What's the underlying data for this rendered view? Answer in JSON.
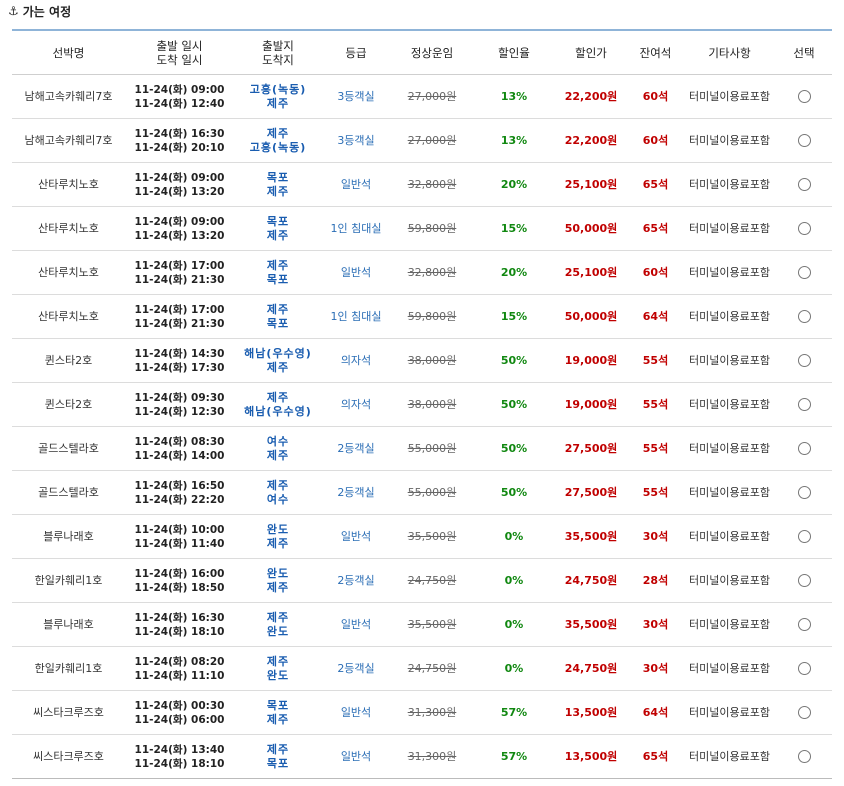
{
  "section": {
    "title": "가는 여정",
    "icon": "anchor-icon"
  },
  "headers": {
    "ship": "선박명",
    "time_top": "출발 일시",
    "time_bottom": "도착 일시",
    "port_top": "출발지",
    "port_bottom": "도착지",
    "grade": "등급",
    "normal": "정상운임",
    "rate": "할인율",
    "price": "할인가",
    "seats": "잔여석",
    "etc": "기타사항",
    "select": "선택"
  },
  "rows": [
    {
      "ship": "남해고속카훼리7호",
      "dep": "11-24(화) 09:00",
      "arr": "11-24(화) 12:40",
      "from": "고흥(녹동)",
      "to": "제주",
      "grade": "3등객실",
      "normal": "27,000원",
      "rate": "13%",
      "price": "22,200원",
      "seats": "60석",
      "etc": "터미널이용료포함"
    },
    {
      "ship": "남해고속카훼리7호",
      "dep": "11-24(화) 16:30",
      "arr": "11-24(화) 20:10",
      "from": "제주",
      "to": "고흥(녹동)",
      "grade": "3등객실",
      "normal": "27,000원",
      "rate": "13%",
      "price": "22,200원",
      "seats": "60석",
      "etc": "터미널이용료포함"
    },
    {
      "ship": "산타루치노호",
      "dep": "11-24(화) 09:00",
      "arr": "11-24(화) 13:20",
      "from": "목포",
      "to": "제주",
      "grade": "일반석",
      "normal": "32,800원",
      "rate": "20%",
      "price": "25,100원",
      "seats": "65석",
      "etc": "터미널이용료포함"
    },
    {
      "ship": "산타루치노호",
      "dep": "11-24(화) 09:00",
      "arr": "11-24(화) 13:20",
      "from": "목포",
      "to": "제주",
      "grade": "1인 침대실",
      "normal": "59,800원",
      "rate": "15%",
      "price": "50,000원",
      "seats": "65석",
      "etc": "터미널이용료포함"
    },
    {
      "ship": "산타루치노호",
      "dep": "11-24(화) 17:00",
      "arr": "11-24(화) 21:30",
      "from": "제주",
      "to": "목포",
      "grade": "일반석",
      "normal": "32,800원",
      "rate": "20%",
      "price": "25,100원",
      "seats": "60석",
      "etc": "터미널이용료포함"
    },
    {
      "ship": "산타루치노호",
      "dep": "11-24(화) 17:00",
      "arr": "11-24(화) 21:30",
      "from": "제주",
      "to": "목포",
      "grade": "1인 침대실",
      "normal": "59,800원",
      "rate": "15%",
      "price": "50,000원",
      "seats": "64석",
      "etc": "터미널이용료포함"
    },
    {
      "ship": "퀸스타2호",
      "dep": "11-24(화) 14:30",
      "arr": "11-24(화) 17:30",
      "from": "해남(우수영)",
      "to": "제주",
      "grade": "의자석",
      "normal": "38,000원",
      "rate": "50%",
      "price": "19,000원",
      "seats": "55석",
      "etc": "터미널이용료포함"
    },
    {
      "ship": "퀸스타2호",
      "dep": "11-24(화) 09:30",
      "arr": "11-24(화) 12:30",
      "from": "제주",
      "to": "해남(우수영)",
      "grade": "의자석",
      "normal": "38,000원",
      "rate": "50%",
      "price": "19,000원",
      "seats": "55석",
      "etc": "터미널이용료포함"
    },
    {
      "ship": "골드스텔라호",
      "dep": "11-24(화) 08:30",
      "arr": "11-24(화) 14:00",
      "from": "여수",
      "to": "제주",
      "grade": "2등객실",
      "normal": "55,000원",
      "rate": "50%",
      "price": "27,500원",
      "seats": "55석",
      "etc": "터미널이용료포함"
    },
    {
      "ship": "골드스텔라호",
      "dep": "11-24(화) 16:50",
      "arr": "11-24(화) 22:20",
      "from": "제주",
      "to": "여수",
      "grade": "2등객실",
      "normal": "55,000원",
      "rate": "50%",
      "price": "27,500원",
      "seats": "55석",
      "etc": "터미널이용료포함"
    },
    {
      "ship": "블루나래호",
      "dep": "11-24(화) 10:00",
      "arr": "11-24(화) 11:40",
      "from": "완도",
      "to": "제주",
      "grade": "일반석",
      "normal": "35,500원",
      "rate": "0%",
      "price": "35,500원",
      "seats": "30석",
      "etc": "터미널이용료포함"
    },
    {
      "ship": "한일카훼리1호",
      "dep": "11-24(화) 16:00",
      "arr": "11-24(화) 18:50",
      "from": "완도",
      "to": "제주",
      "grade": "2등객실",
      "normal": "24,750원",
      "rate": "0%",
      "price": "24,750원",
      "seats": "28석",
      "etc": "터미널이용료포함"
    },
    {
      "ship": "블루나래호",
      "dep": "11-24(화) 16:30",
      "arr": "11-24(화) 18:10",
      "from": "제주",
      "to": "완도",
      "grade": "일반석",
      "normal": "35,500원",
      "rate": "0%",
      "price": "35,500원",
      "seats": "30석",
      "etc": "터미널이용료포함"
    },
    {
      "ship": "한일카훼리1호",
      "dep": "11-24(화) 08:20",
      "arr": "11-24(화) 11:10",
      "from": "제주",
      "to": "완도",
      "grade": "2등객실",
      "normal": "24,750원",
      "rate": "0%",
      "price": "24,750원",
      "seats": "30석",
      "etc": "터미널이용료포함"
    },
    {
      "ship": "씨스타크루즈호",
      "dep": "11-24(화) 00:30",
      "arr": "11-24(화) 06:00",
      "from": "목포",
      "to": "제주",
      "grade": "일반석",
      "normal": "31,300원",
      "rate": "57%",
      "price": "13,500원",
      "seats": "64석",
      "etc": "터미널이용료포함"
    },
    {
      "ship": "씨스타크루즈호",
      "dep": "11-24(화) 13:40",
      "arr": "11-24(화) 18:10",
      "from": "제주",
      "to": "목포",
      "grade": "일반석",
      "normal": "31,300원",
      "rate": "57%",
      "price": "13,500원",
      "seats": "65석",
      "etc": "터미널이용료포함"
    }
  ]
}
